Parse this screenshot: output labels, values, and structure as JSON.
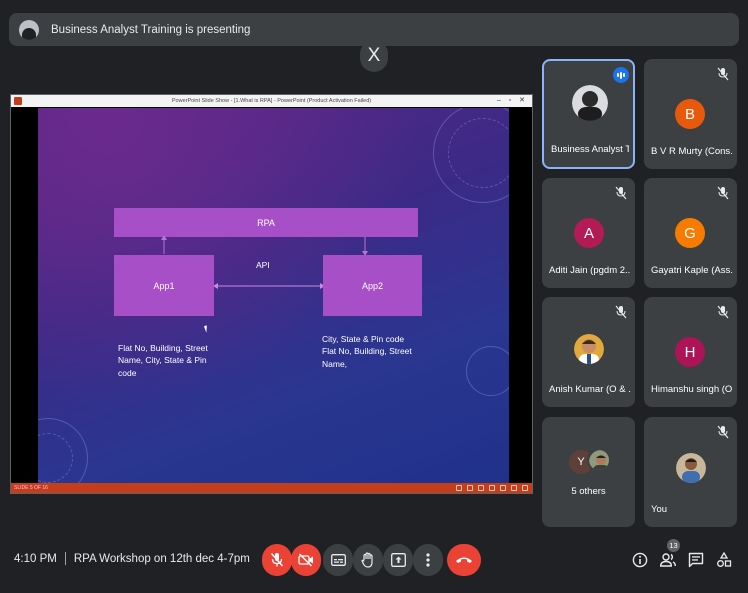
{
  "banner": {
    "text": "Business Analyst Training is presenting"
  },
  "close_label": "X",
  "slide_window": {
    "title": "PowerPoint Slide Show - [1.What is RPA] - PowerPoint (Product Activation Failed)",
    "window_controls": "– ▫ ✕",
    "status": "SLIDE 5 OF 16"
  },
  "slide": {
    "rpa_box": "RPA",
    "api_label": "API",
    "app1": "App1",
    "app2": "App2",
    "left_text": [
      "Flat No, Building, Street",
      "Name, City, State & Pin",
      "code"
    ],
    "right_text": [
      "City, State & Pin code",
      "Flat No, Building, Street",
      "Name,"
    ]
  },
  "participants": [
    {
      "name": "Business Analyst Tr...",
      "type": "photo",
      "speaking": true
    },
    {
      "name": "B V R Murty (Cons...",
      "type": "letter",
      "letter": "B",
      "color": "#e8590c",
      "muted": true
    },
    {
      "name": "Aditi Jain (pgdm 2...",
      "type": "letter",
      "letter": "A",
      "color": "#b31b54",
      "muted": true
    },
    {
      "name": "Gayatri Kaple (Ass...",
      "type": "letter",
      "letter": "G",
      "color": "#f57c00",
      "muted": true
    },
    {
      "name": "Anish Kumar (O & ...",
      "type": "photo",
      "muted": true
    },
    {
      "name": "Himanshu singh (O...",
      "type": "letter",
      "letter": "H",
      "color": "#ad1457",
      "muted": true
    },
    {
      "name": "5 others",
      "type": "group",
      "letter": "Y"
    },
    {
      "name": "You",
      "type": "photo",
      "muted": true
    }
  ],
  "meeting": {
    "time": "4:10 PM",
    "title": "RPA Workshop on 12th dec 4-7pm"
  },
  "people_count": "13",
  "colors": {
    "background": "#202124",
    "tile": "#3c4043",
    "danger": "#ea4335",
    "accent": "#8ab4f8"
  }
}
